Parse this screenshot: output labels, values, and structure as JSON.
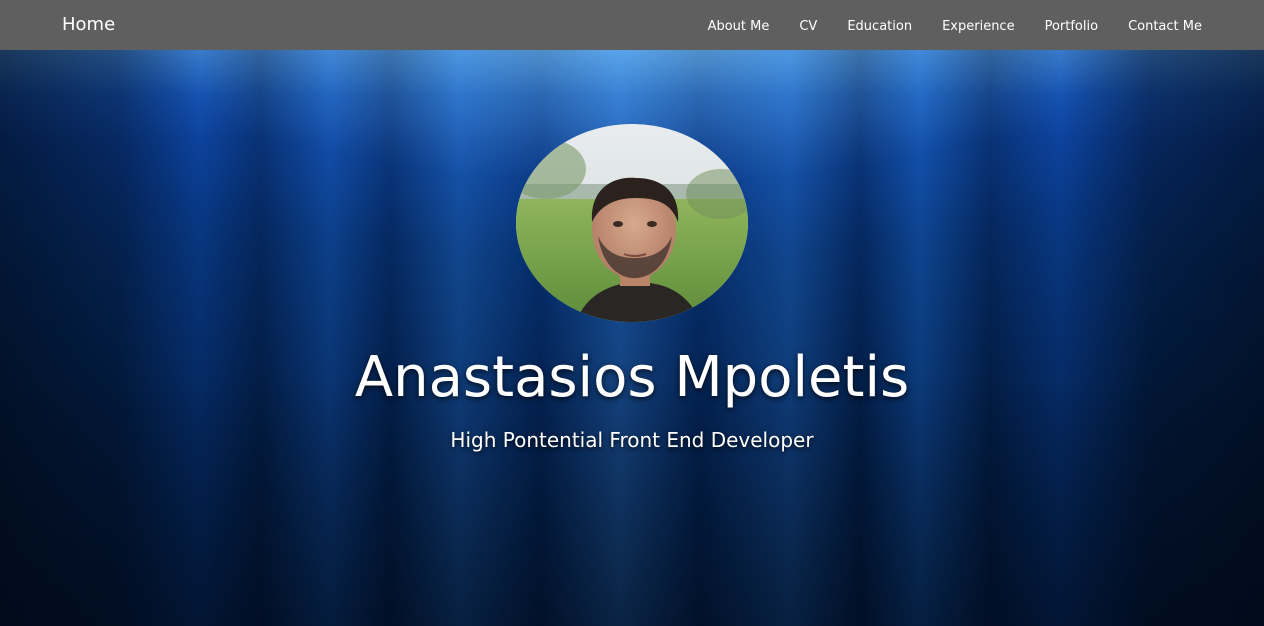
{
  "navbar": {
    "brand": "Home",
    "links": [
      {
        "label": "About Me"
      },
      {
        "label": "CV"
      },
      {
        "label": "Education"
      },
      {
        "label": "Experience"
      },
      {
        "label": "Portfolio"
      },
      {
        "label": "Contact Me"
      }
    ]
  },
  "hero": {
    "name": "Anastasios Mpoletis",
    "subtitle": "High Pontential Front End Developer",
    "avatar_icon": "profile-photo"
  },
  "colors": {
    "navbar_bg": "#5f5f5f",
    "text": "#ffffff",
    "hero_deep": "#021838",
    "hero_light": "#0a4fb8"
  }
}
